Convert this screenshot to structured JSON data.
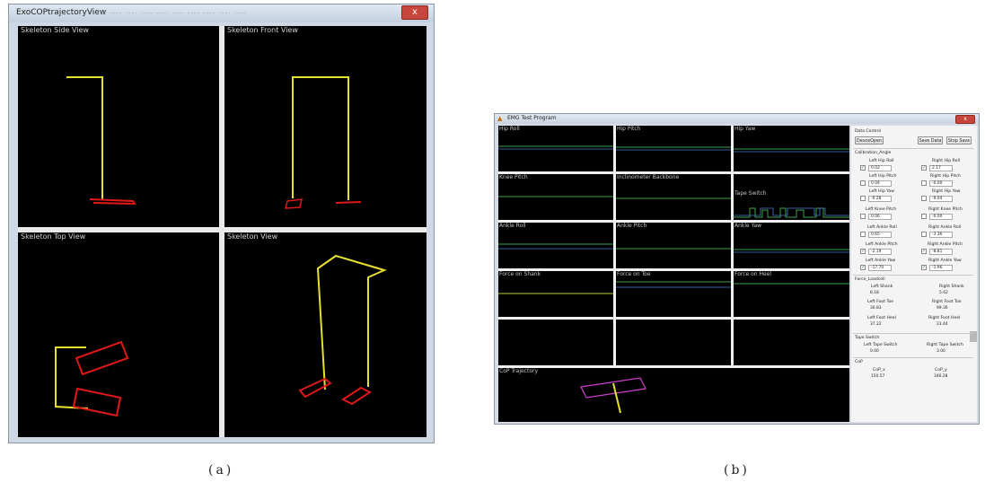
{
  "window_a": {
    "title": "ExoCOPtrajectoryView",
    "menu": "---- ---- ---- ---- ---- ---- ---- ---- ---- ----",
    "close": "x",
    "views": [
      {
        "label": "Skeleton Side View"
      },
      {
        "label": "Skeleton Front View"
      },
      {
        "label": "Skeleton Top View"
      },
      {
        "label": "Skeleton View"
      }
    ]
  },
  "window_b": {
    "title": "EMG Test Program",
    "icon": "app-icon",
    "close": "x",
    "plots": [
      "Hip Roll",
      "Hip Pitch",
      "Hip Yaw",
      "Knee Pitch",
      "Inclinometer Backbone",
      "Tape Switch",
      "Ankle Roll",
      "Ankle Pitch",
      "Ankle Yaw",
      "Force on Shank",
      "Force on Toe",
      "Force on Heel",
      "",
      "",
      "",
      "CoP Trajectory"
    ],
    "panel": {
      "data_control": "Data Control",
      "buttons": {
        "dev_open": "DevceOpen",
        "save_data": "Save Data",
        "stop_save": "Stop Save"
      },
      "calibration": "Calibration_Angle",
      "angles": [
        {
          "left_label": "Left Hip Roll",
          "left_val": "0.02",
          "left_checked": true,
          "right_label": "Right Hip Roll",
          "right_val": "2.17",
          "right_checked": true
        },
        {
          "left_label": "Left Hip Pitch",
          "left_val": "0.04",
          "left_checked": false,
          "right_label": "Right Hip Pitch",
          "right_val": "-0.00",
          "right_checked": false
        },
        {
          "left_label": "Left Hip Yaw",
          "left_val": "-0.28",
          "left_checked": false,
          "right_label": "Right Hip Yaw",
          "right_val": "-9.04",
          "right_checked": false
        },
        {
          "left_label": "Left Knee Pitch",
          "left_val": "0.06",
          "left_checked": false,
          "right_label": "Right Knee Pitch",
          "right_val": "-0.00",
          "right_checked": false
        },
        {
          "left_label": "Left Ankle Roll",
          "left_val": "0.65",
          "left_checked": false,
          "right_label": "Right Ankle Roll",
          "right_val": "-3.36",
          "right_checked": false
        },
        {
          "left_label": "Left Ankle Pitch",
          "left_val": "-2.19",
          "left_checked": true,
          "right_label": "Right Ankle Pitch",
          "right_val": "-8.81",
          "right_checked": true
        },
        {
          "left_label": "Left Ankle Yaw",
          "left_val": "-17.70",
          "left_checked": true,
          "right_label": "Right Ankle Yaw",
          "right_val": "-1.96",
          "right_checked": true
        }
      ],
      "force_section": "Force_Loadcell",
      "forces": [
        {
          "left_label": "Left Shank",
          "left_val": "8.18",
          "right_label": "Right Shank",
          "right_val": "5.62"
        },
        {
          "left_label": "Left Foot Toe",
          "left_val": "30.83",
          "right_label": "Right Foot Toe",
          "right_val": "99.36"
        },
        {
          "left_label": "Left Foot Heel",
          "left_val": "37.22",
          "right_label": "Right Foot Heel",
          "right_val": "23.44"
        }
      ],
      "tape_section": "Tape Switch",
      "tape": {
        "left_label": "Left Tape Switch",
        "left_val": "0.00",
        "right_label": "Right Tape Switch",
        "right_val": "3.00"
      },
      "cop_section": "CoP",
      "cop": {
        "x_label": "CoP_x",
        "x_val": "150.57",
        "y_label": "CoP_y",
        "y_val": "346.28"
      }
    }
  },
  "captions": {
    "a": "(a)",
    "b": "(b)"
  },
  "colors": {
    "skeleton": "#e8e030",
    "feet": "#e01818",
    "cop_plate": "#d040d0",
    "plot_trace": "#3aa24a",
    "plot_trace2": "#4a7ad0"
  }
}
